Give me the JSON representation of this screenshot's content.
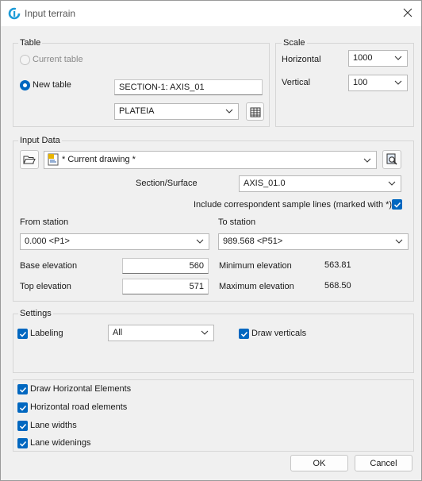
{
  "window": {
    "title": "Input terrain"
  },
  "table": {
    "group_label": "Table",
    "current_table_label": "Current table",
    "new_table_label": "New table",
    "section_name_value": "SECTION-1: AXIS_01",
    "layer_value": "PLATEIA"
  },
  "scale": {
    "group_label": "Scale",
    "horizontal_label": "Horizontal",
    "horizontal_value": "1000",
    "vertical_label": "Vertical",
    "vertical_value": "100"
  },
  "input_data": {
    "group_label": "Input Data",
    "drawing_value": "* Current drawing *",
    "section_surface_label": "Section/Surface",
    "section_surface_value": "AXIS_01.0",
    "include_samples_label": "Include correspondent sample lines (marked with *)",
    "from_station_label": "From station",
    "from_station_value": "0.000 <P1>",
    "to_station_label": "To station",
    "to_station_value": "989.568 <P51>",
    "base_elevation_label": "Base elevation",
    "base_elevation_value": "560",
    "top_elevation_label": "Top elevation",
    "top_elevation_value": "571",
    "min_elevation_label": "Minimum elevation",
    "min_elevation_value": "563.81",
    "max_elevation_label": "Maximum elevation",
    "max_elevation_value": "568.50"
  },
  "settings": {
    "group_label": "Settings",
    "labeling_label": "Labeling",
    "labeling_value": "All",
    "draw_verticals_label": "Draw verticals"
  },
  "elements": {
    "draw_horizontal_label": "Draw Horizontal Elements",
    "horizontal_road_label": "Horizontal road elements",
    "lane_widths_label": "Lane widths",
    "lane_widenings_label": "Lane widenings"
  },
  "buttons": {
    "ok_label": "OK",
    "cancel_label": "Cancel"
  },
  "colors": {
    "accent": "#0067c0",
    "window_bg": "#f0f0f0",
    "title_bg": "#ffffff"
  }
}
